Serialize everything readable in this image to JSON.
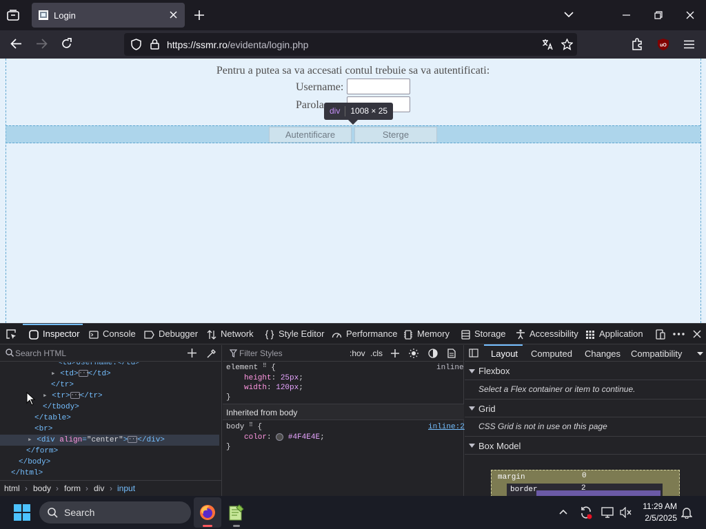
{
  "browser": {
    "tab_title": "Login",
    "url_host": "https://ssmr.ro",
    "url_path": "/evidenta/login.php"
  },
  "page": {
    "intro": "Pentru a putea sa va accesati contul trebuie sa va autentificati:",
    "username_label": "Username:",
    "password_label": "Parola:",
    "login_button": "Autentificare",
    "clear_button": "Sterge",
    "tooltip_tag": "div",
    "tooltip_size": "1008 × 25"
  },
  "devtools": {
    "tabs": [
      "Inspector",
      "Console",
      "Debugger",
      "Network",
      "Style Editor",
      "Performance",
      "Memory",
      "Storage",
      "Accessibility",
      "Application"
    ],
    "search_placeholder": "Search HTML",
    "markup": {
      "l0": "<td>Username:</td>",
      "l1a": "<td>",
      "l1b": "</td>",
      "l2": "</tr>",
      "l3a": "<tr>",
      "l3b": "</tr>",
      "l4": "</tbody>",
      "l5": "</table>",
      "l6": "<br>",
      "l7_tag": "<div ",
      "l7_attr": "align",
      "l7_val": "\"center\"",
      "l7_end": ">",
      "l7_close": "</div>",
      "l8": "</form>",
      "l9": "</body>",
      "l10": "</html>"
    },
    "breadcrumbs": [
      "html",
      "body",
      "form",
      "div",
      "input"
    ],
    "rules": {
      "filter_placeholder": "Filter Styles",
      "hov": ":hov",
      "cls": ".cls",
      "element_selector": "element",
      "inline_label": "inline",
      "height_prop": "height",
      "height_val": "25px",
      "width_prop": "width",
      "width_val": "120px",
      "inherited_header": "Inherited from body",
      "body_selector": "body",
      "body_source": "inline:2",
      "color_prop": "color",
      "color_val": "#4F4E4E",
      "open_brace": "{",
      "close_brace": "}",
      "semicolon": ";",
      "colon": ":"
    },
    "layout_tabs": [
      "Layout",
      "Computed",
      "Changes",
      "Compatibility"
    ],
    "flexbox_header": "Flexbox",
    "flexbox_note": "Select a Flex container or item to continue.",
    "grid_header": "Grid",
    "grid_note": "CSS Grid is not in use on this page",
    "boxmodel_header": "Box Model",
    "boxmodel": {
      "margin_label": "margin",
      "margin_value": "0",
      "border_label": "border",
      "border_value": "2"
    }
  },
  "taskbar": {
    "search_label": "Search",
    "time": "11:29 AM",
    "date": "2/5/2025"
  },
  "colors": {
    "page_bg": "#e5f1fb",
    "text": "#4F4E4E",
    "accent": "#75bfff"
  }
}
